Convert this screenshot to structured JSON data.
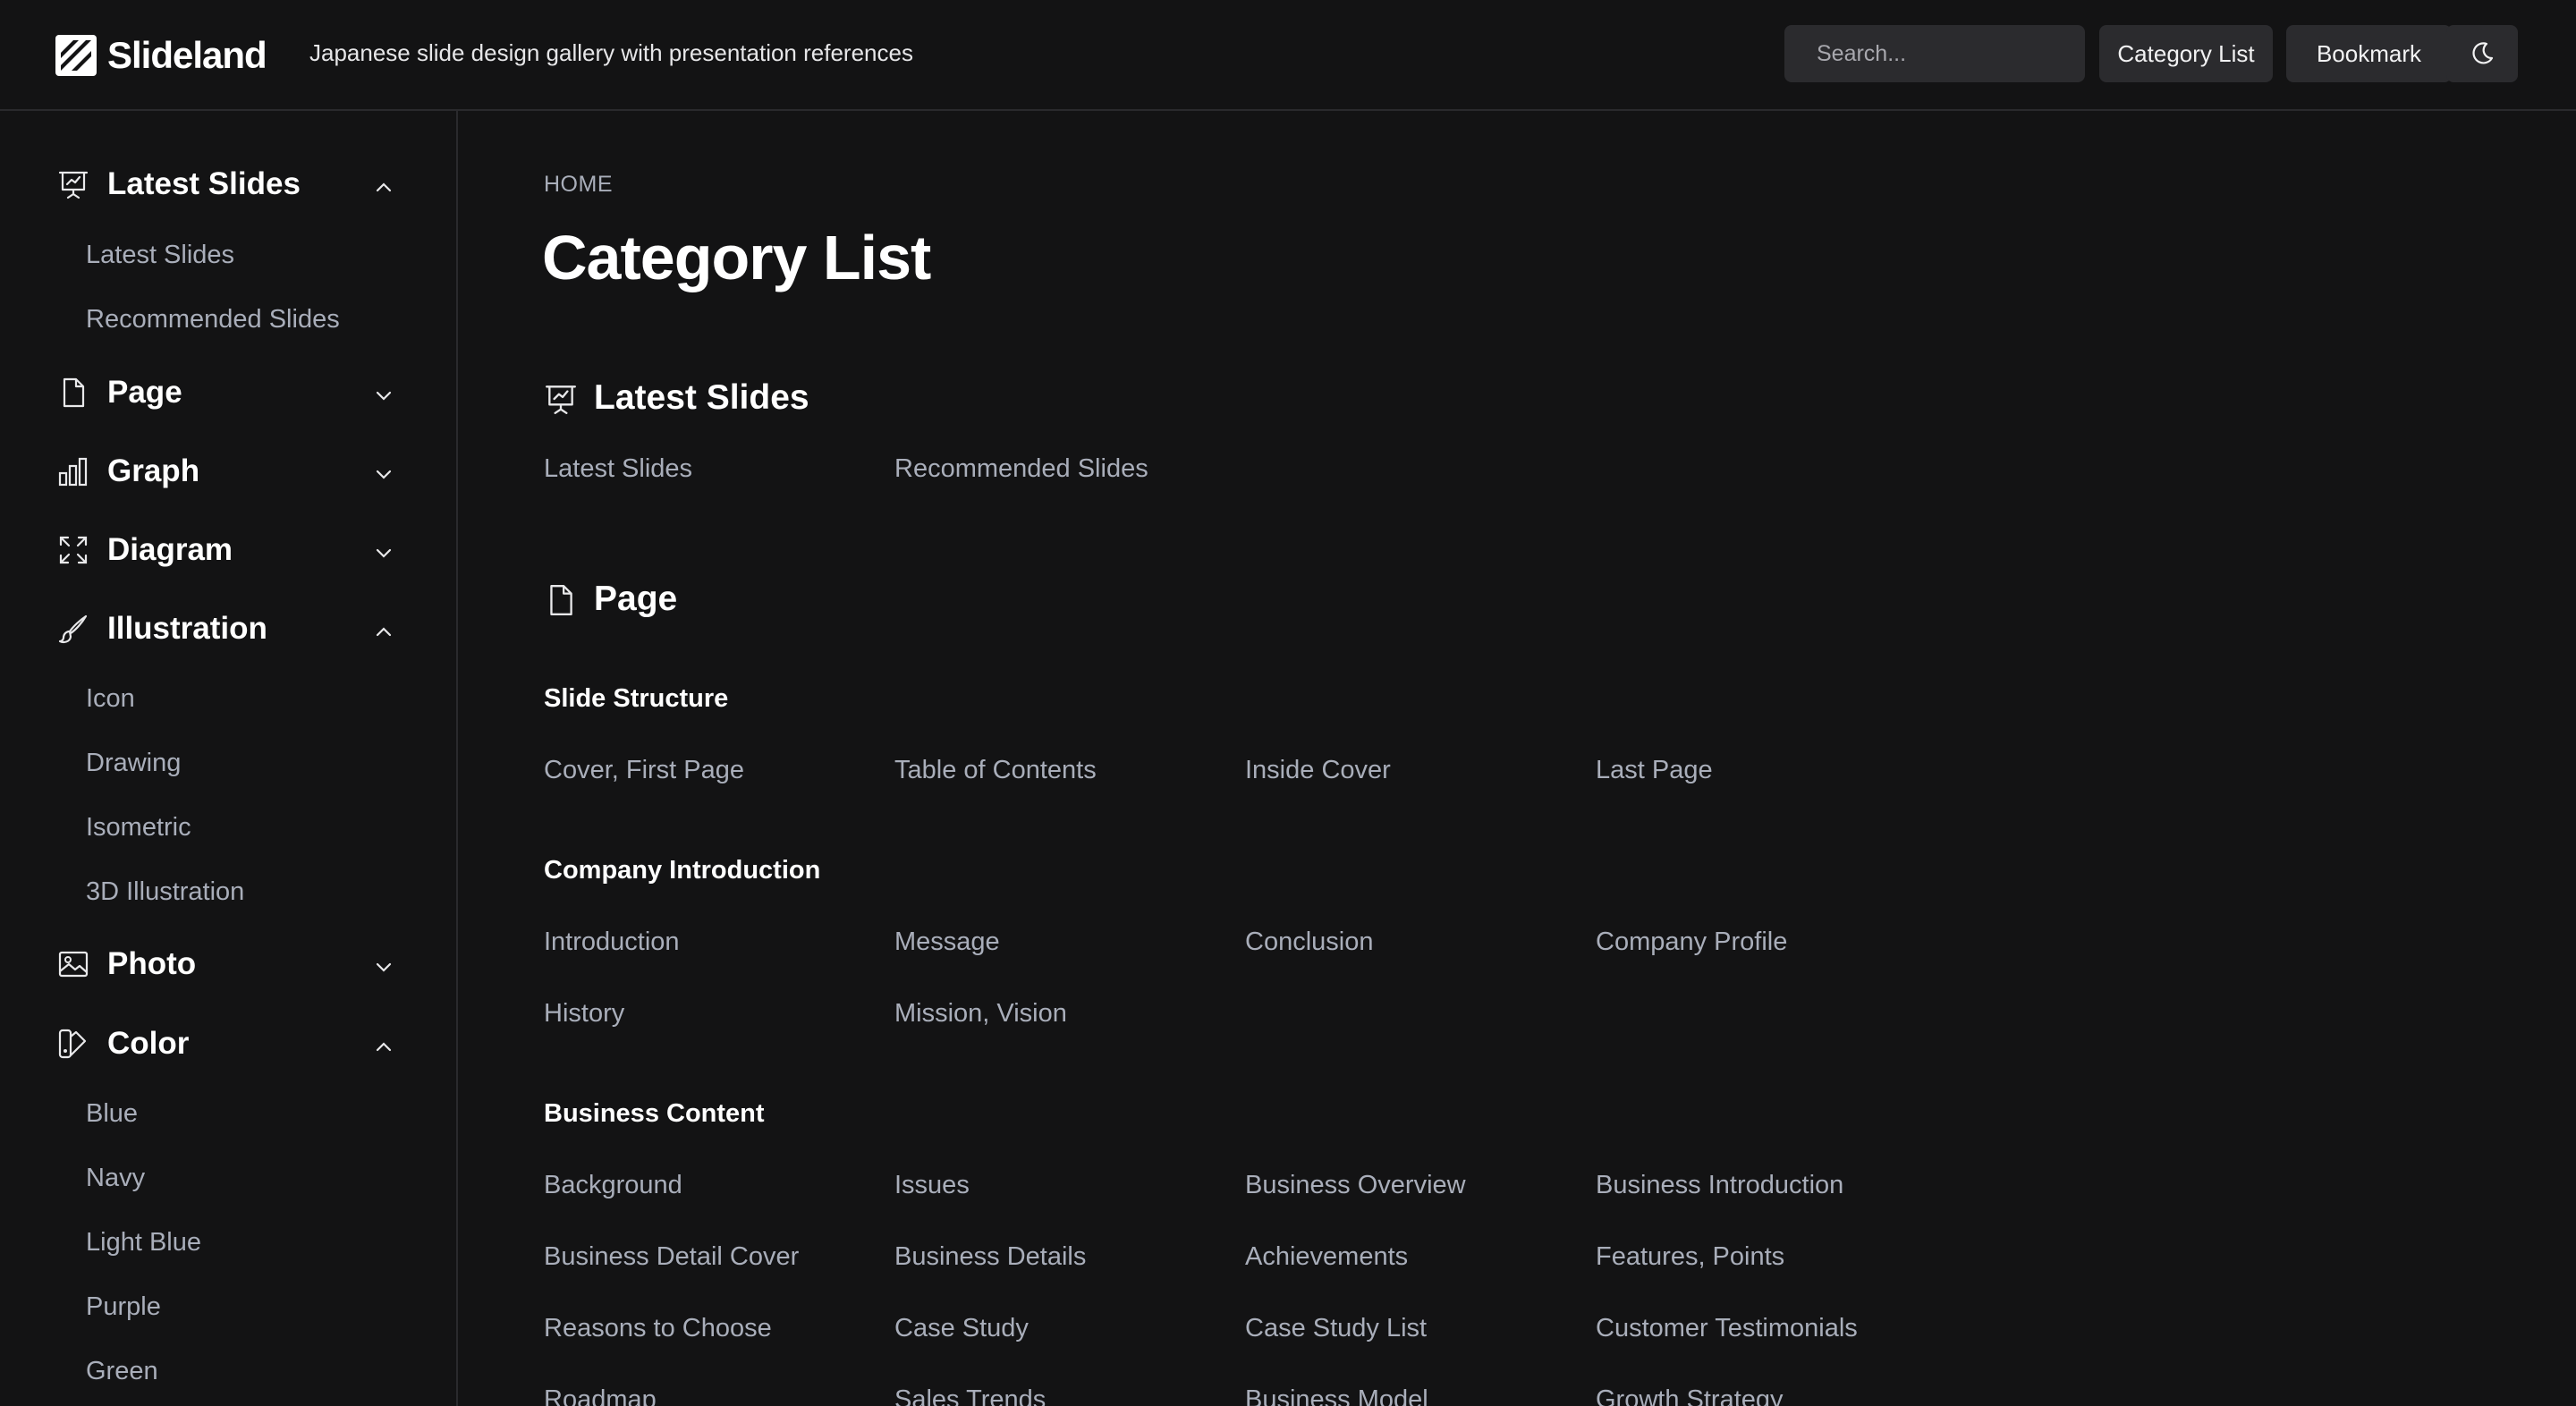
{
  "header": {
    "logo_text": "Slideland",
    "tagline": "Japanese slide design gallery with presentation references",
    "search_placeholder": "Search...",
    "category_list_label": "Category List",
    "bookmark_label": "Bookmark"
  },
  "sidebar": {
    "latest": {
      "label": "Latest Slides",
      "items": [
        "Latest Slides",
        "Recommended Slides"
      ]
    },
    "page": {
      "label": "Page"
    },
    "graph": {
      "label": "Graph"
    },
    "diagram": {
      "label": "Diagram"
    },
    "illustration": {
      "label": "Illustration",
      "items": [
        "Icon",
        "Drawing",
        "Isometric",
        "3D Illustration"
      ]
    },
    "photo": {
      "label": "Photo"
    },
    "color": {
      "label": "Color",
      "items": [
        "Blue",
        "Navy",
        "Light Blue",
        "Purple",
        "Green"
      ]
    }
  },
  "main": {
    "breadcrumb": "HOME",
    "title": "Category List",
    "latest_section": {
      "title": "Latest Slides",
      "links": [
        "Latest Slides",
        "Recommended Slides"
      ]
    },
    "page_section": {
      "title": "Page",
      "groups": [
        {
          "name": "Slide Structure",
          "links": [
            "Cover, First Page",
            "Table of Contents",
            "Inside Cover",
            "Last Page"
          ]
        },
        {
          "name": "Company Introduction",
          "links": [
            "Introduction",
            "Message",
            "Conclusion",
            "Company Profile",
            "History",
            "Mission, Vision"
          ]
        },
        {
          "name": "Business Content",
          "links": [
            "Background",
            "Issues",
            "Business Overview",
            "Business Introduction",
            "Business Detail Cover",
            "Business Details",
            "Achievements",
            "Features, Points",
            "Reasons to Choose",
            "Case Study",
            "Case Study List",
            "Customer Testimonials",
            "Roadmap",
            "Sales Trends",
            "Business Model",
            "Growth Strategy"
          ]
        }
      ]
    }
  }
}
